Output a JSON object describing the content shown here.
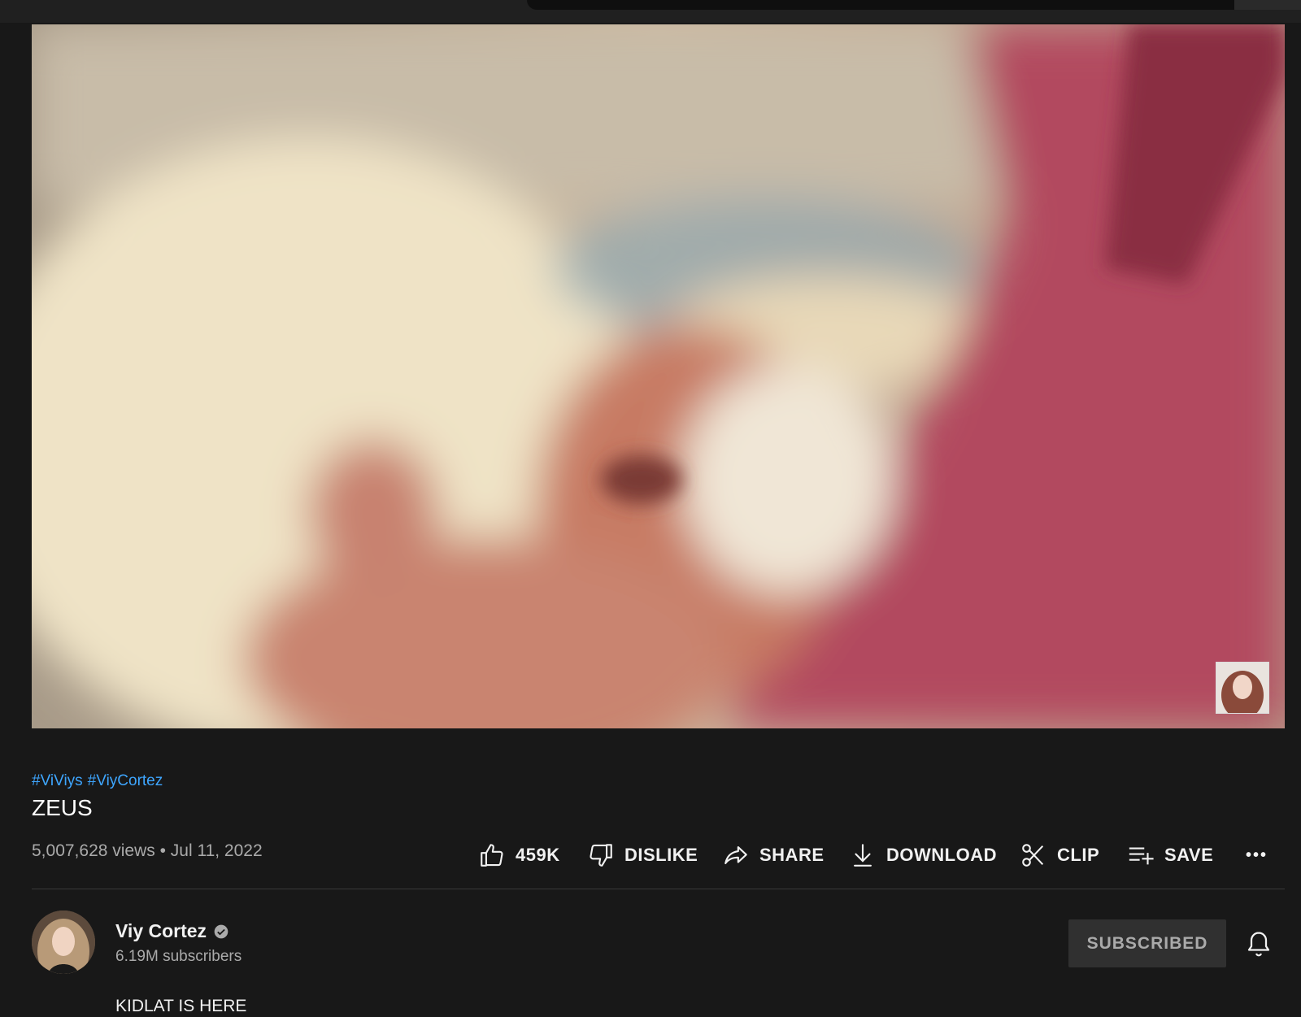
{
  "hashtags": [
    "#ViViys",
    "#ViyCortez"
  ],
  "video": {
    "title": "ZEUS",
    "meta": "5,007,628 views • Jul 11, 2022"
  },
  "actions": {
    "like_label": "459K",
    "dislike_label": "DISLIKE",
    "share_label": "SHARE",
    "download_label": "DOWNLOAD",
    "clip_label": "CLIP",
    "save_label": "SAVE",
    "more_label": "•••"
  },
  "channel": {
    "name": "Viy Cortez",
    "subscribers": "6.19M subscribers",
    "subscribe_label": "SUBSCRIBED"
  },
  "description": "KIDLAT IS HERE",
  "colors": {
    "background": "#181818",
    "hashtag": "#3ea6ff",
    "subscribed_button": "#303030"
  },
  "icons": [
    "thumbs-up-icon",
    "thumbs-down-icon",
    "share-icon",
    "download-icon",
    "scissors-icon",
    "playlist-add-icon",
    "more-icon",
    "verified-icon",
    "bell-icon"
  ]
}
